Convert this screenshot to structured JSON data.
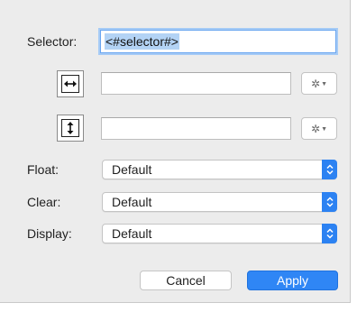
{
  "selector": {
    "label": "Selector:",
    "value": "<#selector#>"
  },
  "width_row": {
    "icon": "horizontal-resize-icon",
    "value": "",
    "menu_icon": "gear-icon"
  },
  "height_row": {
    "icon": "vertical-resize-icon",
    "value": "",
    "menu_icon": "gear-icon"
  },
  "float": {
    "label": "Float:",
    "value": "Default"
  },
  "clear": {
    "label": "Clear:",
    "value": "Default"
  },
  "display": {
    "label": "Display:",
    "value": "Default"
  },
  "buttons": {
    "cancel": "Cancel",
    "apply": "Apply"
  },
  "colors": {
    "accent": "#2f86f5",
    "focus_ring": "#a6cbf6",
    "panel_bg": "#ececec"
  }
}
